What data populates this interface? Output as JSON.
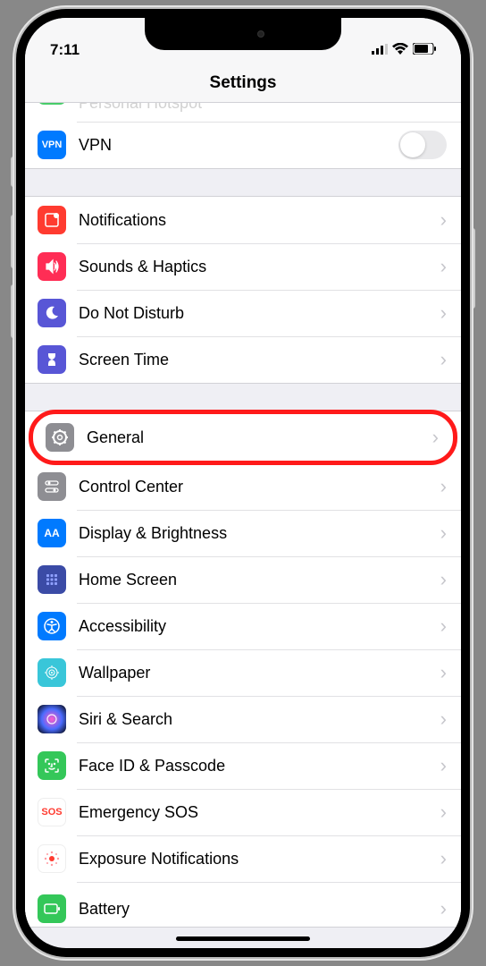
{
  "status": {
    "time": "7:11"
  },
  "header": {
    "title": "Settings"
  },
  "groups": [
    {
      "rows": [
        {
          "id": "hotspot",
          "label": "Personal Hotspot",
          "icon": "hotspot",
          "partial": true
        },
        {
          "id": "vpn",
          "label": "VPN",
          "icon": "vpn",
          "toggle": false
        }
      ]
    },
    {
      "rows": [
        {
          "id": "notifications",
          "label": "Notifications",
          "icon": "notif",
          "chevron": true
        },
        {
          "id": "sounds",
          "label": "Sounds & Haptics",
          "icon": "sounds",
          "chevron": true
        },
        {
          "id": "dnd",
          "label": "Do Not Disturb",
          "icon": "dnd",
          "chevron": true
        },
        {
          "id": "screentime",
          "label": "Screen Time",
          "icon": "screentime",
          "chevron": true
        }
      ]
    },
    {
      "rows": [
        {
          "id": "general",
          "label": "General",
          "icon": "general",
          "chevron": true,
          "highlighted": true
        },
        {
          "id": "control",
          "label": "Control Center",
          "icon": "control",
          "chevron": true
        },
        {
          "id": "display",
          "label": "Display & Brightness",
          "icon": "display",
          "chevron": true
        },
        {
          "id": "homescreen",
          "label": "Home Screen",
          "icon": "home",
          "chevron": true
        },
        {
          "id": "accessibility",
          "label": "Accessibility",
          "icon": "access",
          "chevron": true
        },
        {
          "id": "wallpaper",
          "label": "Wallpaper",
          "icon": "wallpaper",
          "chevron": true
        },
        {
          "id": "siri",
          "label": "Siri & Search",
          "icon": "siri",
          "chevron": true
        },
        {
          "id": "faceid",
          "label": "Face ID & Passcode",
          "icon": "faceid",
          "chevron": true
        },
        {
          "id": "sos",
          "label": "Emergency SOS",
          "icon": "sos",
          "chevron": true
        },
        {
          "id": "exposure",
          "label": "Exposure Notifications",
          "icon": "exposure",
          "chevron": true
        },
        {
          "id": "battery",
          "label": "Battery",
          "icon": "battery",
          "chevron": true,
          "partial_bottom": true
        }
      ]
    }
  ]
}
